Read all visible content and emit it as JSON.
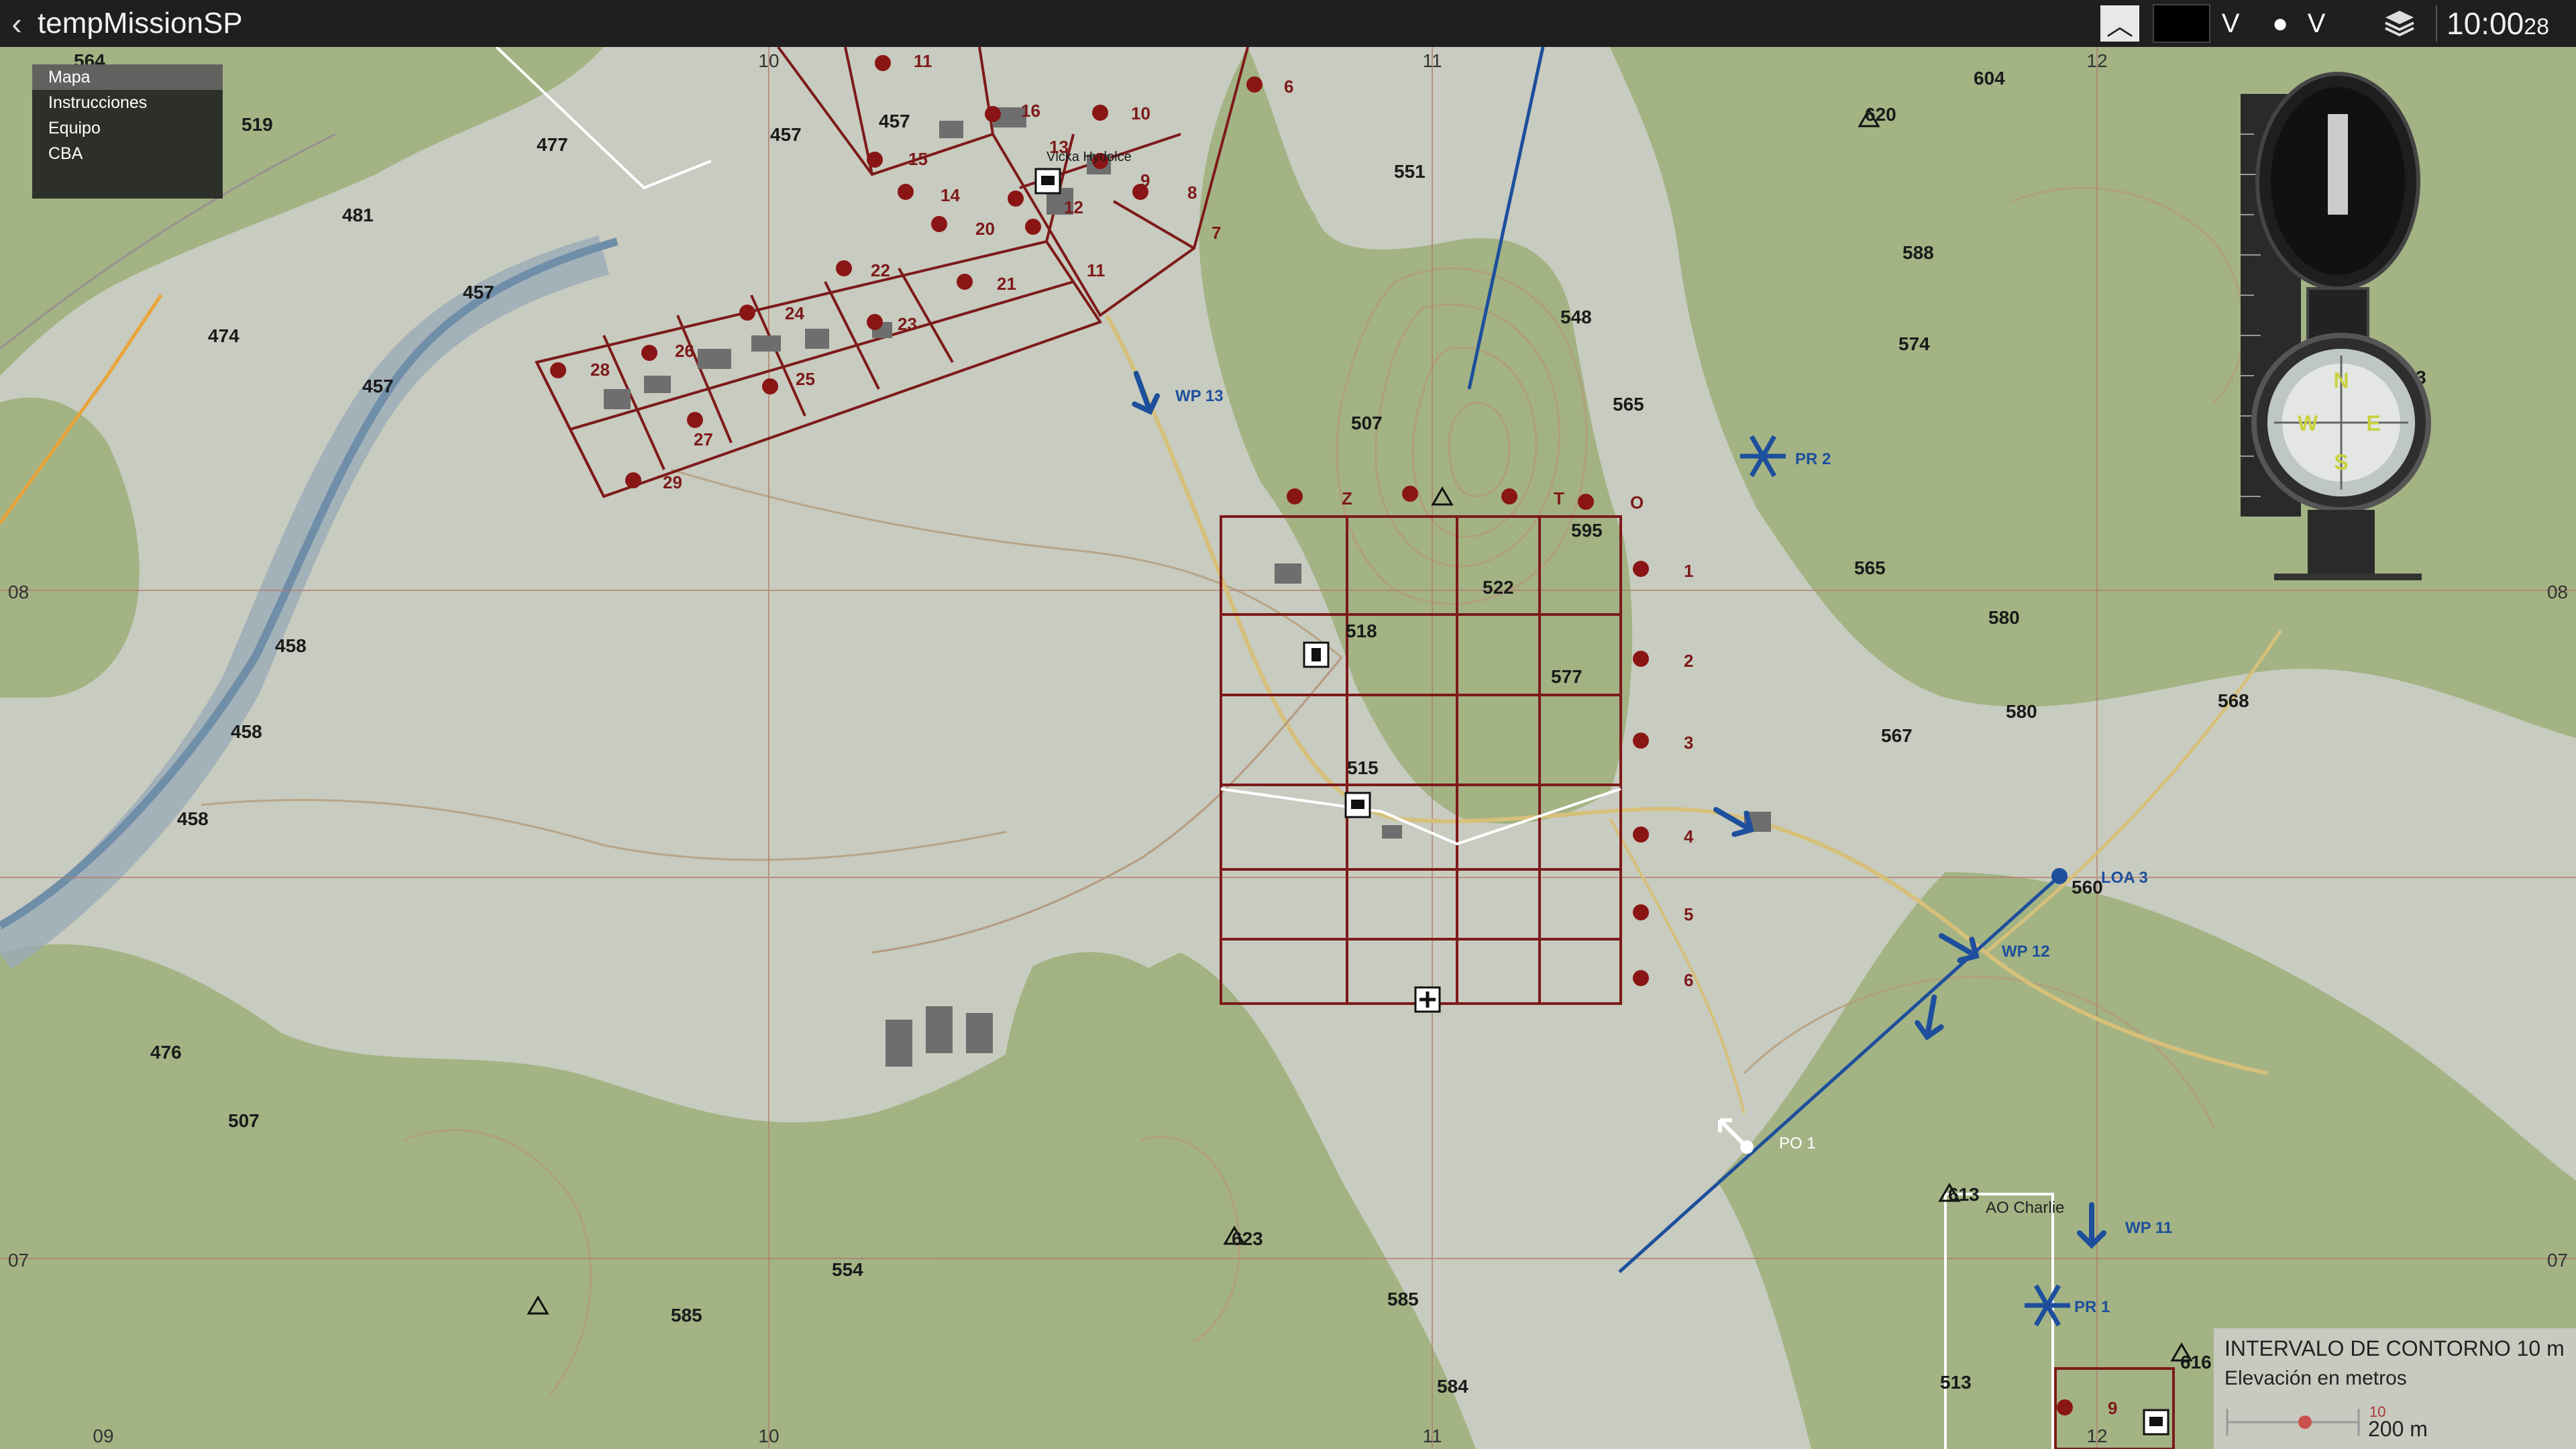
{
  "topbar": {
    "title": "tempMissionSP",
    "back_glyph": "‹",
    "up_glyph": "︿",
    "v_glyph": "V",
    "dot_glyph": "●",
    "time_main": "10:00",
    "time_sec": "28"
  },
  "side_menu": {
    "items": [
      "Mapa",
      "Instrucciones",
      "Equipo",
      "CBA"
    ]
  },
  "legend": {
    "contour": "INTERVALO DE CONTORNO 10 m",
    "elevation": "Elevación en metros",
    "scale_value": "10",
    "scale": "200 m"
  },
  "grid": {
    "top": [
      "10",
      "11",
      "12"
    ],
    "bottom": [
      "09",
      "10",
      "11",
      "12"
    ],
    "left": [
      "08",
      "07"
    ],
    "right": [
      "08",
      "07"
    ]
  },
  "elevations": [
    "564",
    "519",
    "477",
    "457",
    "457",
    "481",
    "457",
    "474",
    "457",
    "551",
    "548",
    "565",
    "507",
    "595",
    "522",
    "518",
    "577",
    "515",
    "604",
    "620",
    "588",
    "574",
    "543",
    "565",
    "580",
    "580",
    "567",
    "568",
    "560",
    "458",
    "458",
    "458",
    "476",
    "507",
    "554",
    "585",
    "585",
    "623",
    "584",
    "613",
    "513",
    "616"
  ],
  "places": [
    "Vlčka Hydolce",
    "AO Charlie"
  ],
  "markers": [
    "WP 13",
    "PR 2",
    "LOA 3",
    "WP 12",
    "PO 1",
    "WP 11",
    "PR 1"
  ],
  "sector_numbers": [
    "11",
    "16",
    "10",
    "15",
    "13",
    "9",
    "8",
    "14",
    "12",
    "7",
    "20",
    "11",
    "22",
    "21",
    "24",
    "23",
    "26",
    "25",
    "28",
    "27",
    "29",
    "6"
  ],
  "grid_letters": [
    "Z",
    "T",
    "O"
  ],
  "grid_digits": [
    "1",
    "2",
    "3",
    "4",
    "5",
    "6"
  ],
  "ao_digits": [
    "9"
  ],
  "colors": {
    "forest": "#9fb07d",
    "open": "#c8cbbf",
    "water": "#9aaab8",
    "sector": "#7d1a1a",
    "marker": "#1d4f9c",
    "contour": "#b39b7a"
  }
}
